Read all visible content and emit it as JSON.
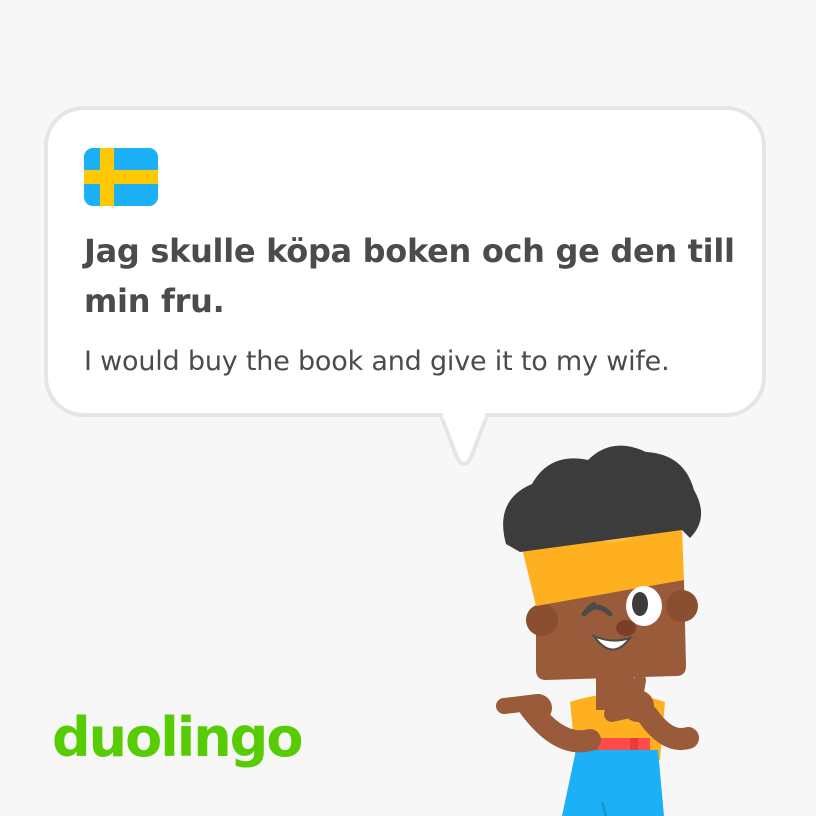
{
  "card": {
    "flag_icon": "sweden-flag-icon",
    "sentence": "Jag skulle köpa boken och ge den till min fru.",
    "translation": "I would buy the book and give it to my wife."
  },
  "brand": {
    "logo_text": "duolingo",
    "logo_color": "#58cc02"
  },
  "character": {
    "icon": "winking-character-illustration"
  },
  "colors": {
    "background": "#f7f7f7",
    "bubble_border": "#e5e5e5",
    "text": "#4b4b4b",
    "flag_blue": "#1cb0f6",
    "flag_yellow": "#ffc800"
  }
}
